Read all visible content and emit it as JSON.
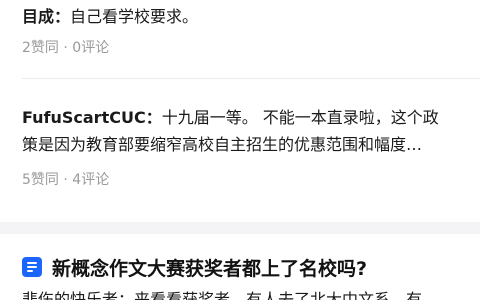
{
  "answers": [
    {
      "author": "目成",
      "sep": "：",
      "lines": [
        "自己看学校要求。"
      ],
      "likes": "2赞同",
      "dot": " · ",
      "comments": "0评论"
    },
    {
      "author": "FufuScartCUC",
      "sep": "：",
      "lines": [
        "十九届一等。 不能一本直录啦，这个政",
        "策是因为教育部要缩窄高校自主招生的优惠范围和幅度…"
      ],
      "likes": "5赞同",
      "dot": " · ",
      "comments": "4评论"
    }
  ],
  "question": {
    "icon": "question-doc-icon",
    "title": "新概念作文大赛获奖者都上了名校吗?",
    "preview": "悲伤的快乐者：来看看获奖者，有人去了北大中文系，有"
  },
  "colors": {
    "accent": "#1a66ff",
    "meta": "#9a9a9a",
    "separator": "#f4f4f6"
  }
}
